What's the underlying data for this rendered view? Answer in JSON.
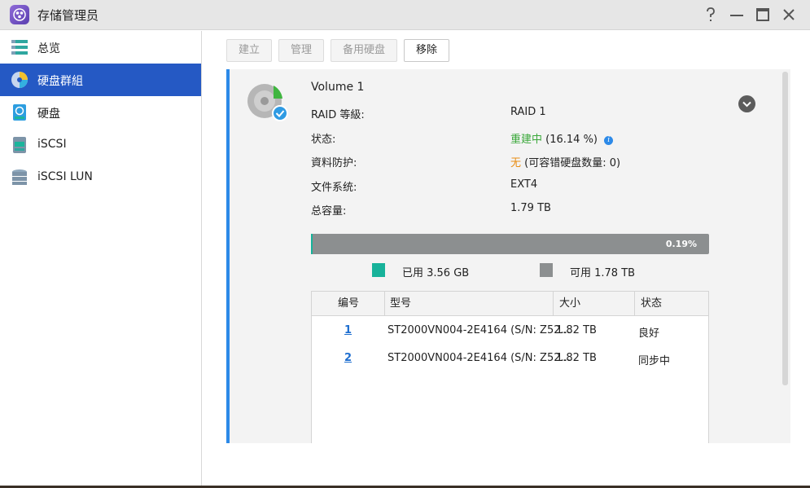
{
  "window": {
    "title": "存储管理员"
  },
  "sidebar": {
    "items": [
      {
        "label": "总览",
        "active": false
      },
      {
        "label": "硬盘群組",
        "active": true
      },
      {
        "label": "硬盘",
        "active": false
      },
      {
        "label": "iSCSI",
        "active": false
      },
      {
        "label": "iSCSI LUN",
        "active": false
      }
    ]
  },
  "toolbar": {
    "create": "建立",
    "manage": "管理",
    "hot_spare": "备用硬盘",
    "remove": "移除"
  },
  "volume": {
    "name": "Volume 1",
    "props": {
      "raid_label": "RAID 等級:",
      "raid_value": "RAID 1",
      "status_label": "状态:",
      "status_state": "重建中",
      "status_progress": "(16.14 %)",
      "protection_label": "資料防护:",
      "protection_state": "无",
      "protection_detail": "(可容错硬盘数量: 0)",
      "filesystem_label": "文件系统:",
      "filesystem_value": "EXT4",
      "capacity_label": "总容量:",
      "capacity_value": "1.79 TB"
    },
    "usage": {
      "percent_label": "0.19%",
      "used_fraction": 0.0019,
      "used_label": "已用 3.56 GB",
      "free_label": "可用 1.78 TB"
    }
  },
  "disk_table": {
    "headers": {
      "num": "编号",
      "model": "型号",
      "size": "大小",
      "status": "状态"
    },
    "rows": [
      {
        "num": "1",
        "model": "ST2000VN004-2E4164 (S/N: Z52...",
        "size": "1.82 TB",
        "status": "良好"
      },
      {
        "num": "2",
        "model": "ST2000VN004-2E4164 (S/N: Z52...",
        "size": "1.82 TB",
        "status": "同步中"
      }
    ]
  },
  "colors": {
    "accent": "#2559c4",
    "panel_border": "#2c8ae8",
    "used": "#17b29a",
    "free": "#8c8f90",
    "rebuilding": "#3aa83a",
    "warning": "#e88d14"
  },
  "icons": {
    "app": "storage-manager-icon",
    "help": "help-icon",
    "minimize": "minimize-icon",
    "maximize": "maximize-icon",
    "close": "close-icon",
    "volume": "volume-disk-icon",
    "collapse": "chevron-down-icon"
  }
}
